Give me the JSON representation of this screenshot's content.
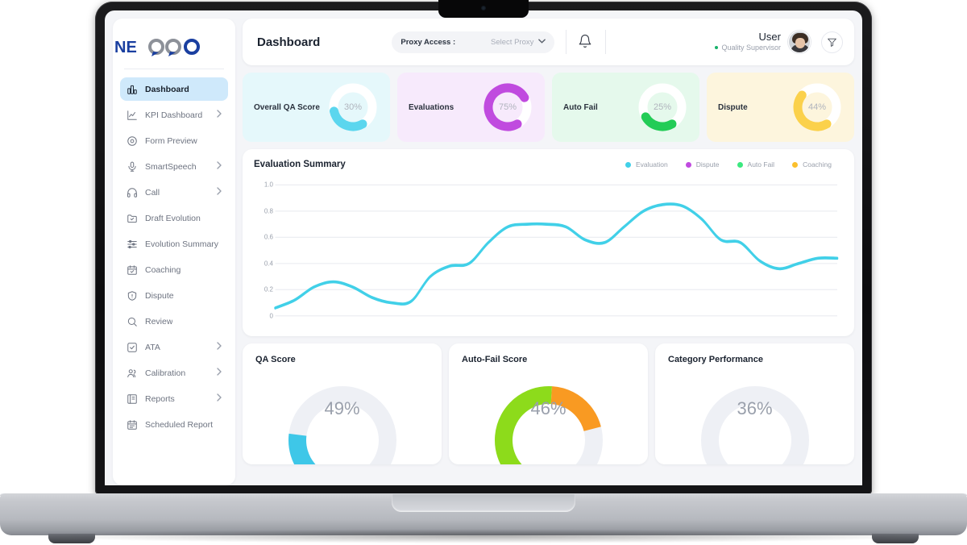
{
  "brand": {
    "logo_text": "NEQQO"
  },
  "sidebar": {
    "items": [
      {
        "label": "Dashboard",
        "icon": "bar-chart-icon",
        "active": true,
        "chevron": false
      },
      {
        "label": "KPI Dashboard",
        "icon": "line-chart-icon",
        "active": false,
        "chevron": true
      },
      {
        "label": "Form Preview",
        "icon": "target-circle-icon",
        "active": false,
        "chevron": false
      },
      {
        "label": "SmartSpeech",
        "icon": "microphone-icon",
        "active": false,
        "chevron": true
      },
      {
        "label": "Call",
        "icon": "headphones-icon",
        "active": false,
        "chevron": true
      },
      {
        "label": "Draft Evolution",
        "icon": "folder-check-icon",
        "active": false,
        "chevron": false
      },
      {
        "label": "Evolution Summary",
        "icon": "sliders-icon",
        "active": false,
        "chevron": false
      },
      {
        "label": "Coaching",
        "icon": "calendar-check-icon",
        "active": false,
        "chevron": false
      },
      {
        "label": "Dispute",
        "icon": "shield-alert-icon",
        "active": false,
        "chevron": false
      },
      {
        "label": "Review",
        "icon": "search-icon",
        "active": false,
        "chevron": false
      },
      {
        "label": "ATA",
        "icon": "square-check-icon",
        "active": false,
        "chevron": true
      },
      {
        "label": "Calibration",
        "icon": "users-icon",
        "active": false,
        "chevron": true
      },
      {
        "label": "Reports",
        "icon": "book-icon",
        "active": false,
        "chevron": true
      },
      {
        "label": "Scheduled Report",
        "icon": "calendar-icon",
        "active": false,
        "chevron": false
      }
    ]
  },
  "topbar": {
    "title": "Dashboard",
    "proxy_label": "Proxy Access :",
    "proxy_value": "Select Proxy",
    "proxy_caret": "⌄",
    "bell_icon": "bell-icon",
    "filter_icon": "filter-funnel-icon",
    "user_name": "User",
    "user_role": "Quality Supervisor",
    "status_color": "#18b26b"
  },
  "kpi_cards": [
    {
      "label": "Overall QA Score",
      "value": "30%",
      "percent": 30,
      "bg": "#e5f8fb",
      "color": "#5bd6ee",
      "track": "#ffffff"
    },
    {
      "label": "Evaluations",
      "value": "75%",
      "percent": 75,
      "bg": "#f7eafc",
      "color": "#c04bdf",
      "track": "#ffffff"
    },
    {
      "label": "Auto Fail",
      "value": "25%",
      "percent": 25,
      "bg": "#e5f9ec",
      "color": "#23cc56",
      "track": "#ffffff"
    },
    {
      "label": "Dispute",
      "value": "44%",
      "percent": 44,
      "bg": "#fdf5dd",
      "color": "#fbd14b",
      "track": "#ffffff"
    }
  ],
  "chart_card": {
    "title": "Evaluation Summary"
  },
  "chart_data": {
    "type": "line",
    "title": "Evaluation Summary",
    "xlabel": "",
    "ylabel": "",
    "ylim": [
      0,
      1.0
    ],
    "yticks": [
      "0",
      "0.2",
      "0.4",
      "0.6",
      "0.8",
      "1.0"
    ],
    "grid": true,
    "legend_position": "top-right",
    "series": [
      {
        "name": "Evaluation",
        "color": "#41d0e8",
        "values": [
          0.06,
          0.12,
          0.22,
          0.26,
          0.22,
          0.14,
          0.1,
          0.11,
          0.3,
          0.38,
          0.4,
          0.56,
          0.68,
          0.7,
          0.7,
          0.68,
          0.58,
          0.56,
          0.68,
          0.8,
          0.85,
          0.84,
          0.74,
          0.58,
          0.56,
          0.42,
          0.36,
          0.4,
          0.44,
          0.44
        ]
      },
      {
        "name": "Dispute",
        "color": "#c04bdf",
        "values": []
      },
      {
        "name": "Auto Fail",
        "color": "#3ce87f",
        "values": []
      },
      {
        "name": "Coaching",
        "color": "#fbc02d",
        "values": []
      }
    ],
    "legend": [
      {
        "label": "Evaluation",
        "color": "#41d0e8"
      },
      {
        "label": "Dispute",
        "color": "#c04bdf"
      },
      {
        "label": "Auto Fail",
        "color": "#3ce87f"
      },
      {
        "label": "Coaching",
        "color": "#fbc02d"
      }
    ]
  },
  "bottom_cards": [
    {
      "title": "QA Score",
      "value": "49%",
      "segments": [
        {
          "percent": 20,
          "color": "#3ad6b4"
        },
        {
          "percent": 18,
          "color": "#3ec7e8"
        }
      ],
      "track": "#eef0f5"
    },
    {
      "title": "Auto-Fail Score",
      "value": "46%",
      "segments": [
        {
          "percent": 62,
          "color": "#8ddb1b"
        },
        {
          "percent": 20,
          "color": "#f99a22"
        }
      ],
      "track": "#eef0f5"
    },
    {
      "title": "Category Performance",
      "value": "36%",
      "segments": [
        {
          "percent": 13,
          "color": "#e146c8"
        }
      ],
      "track": "#eef0f5"
    }
  ]
}
